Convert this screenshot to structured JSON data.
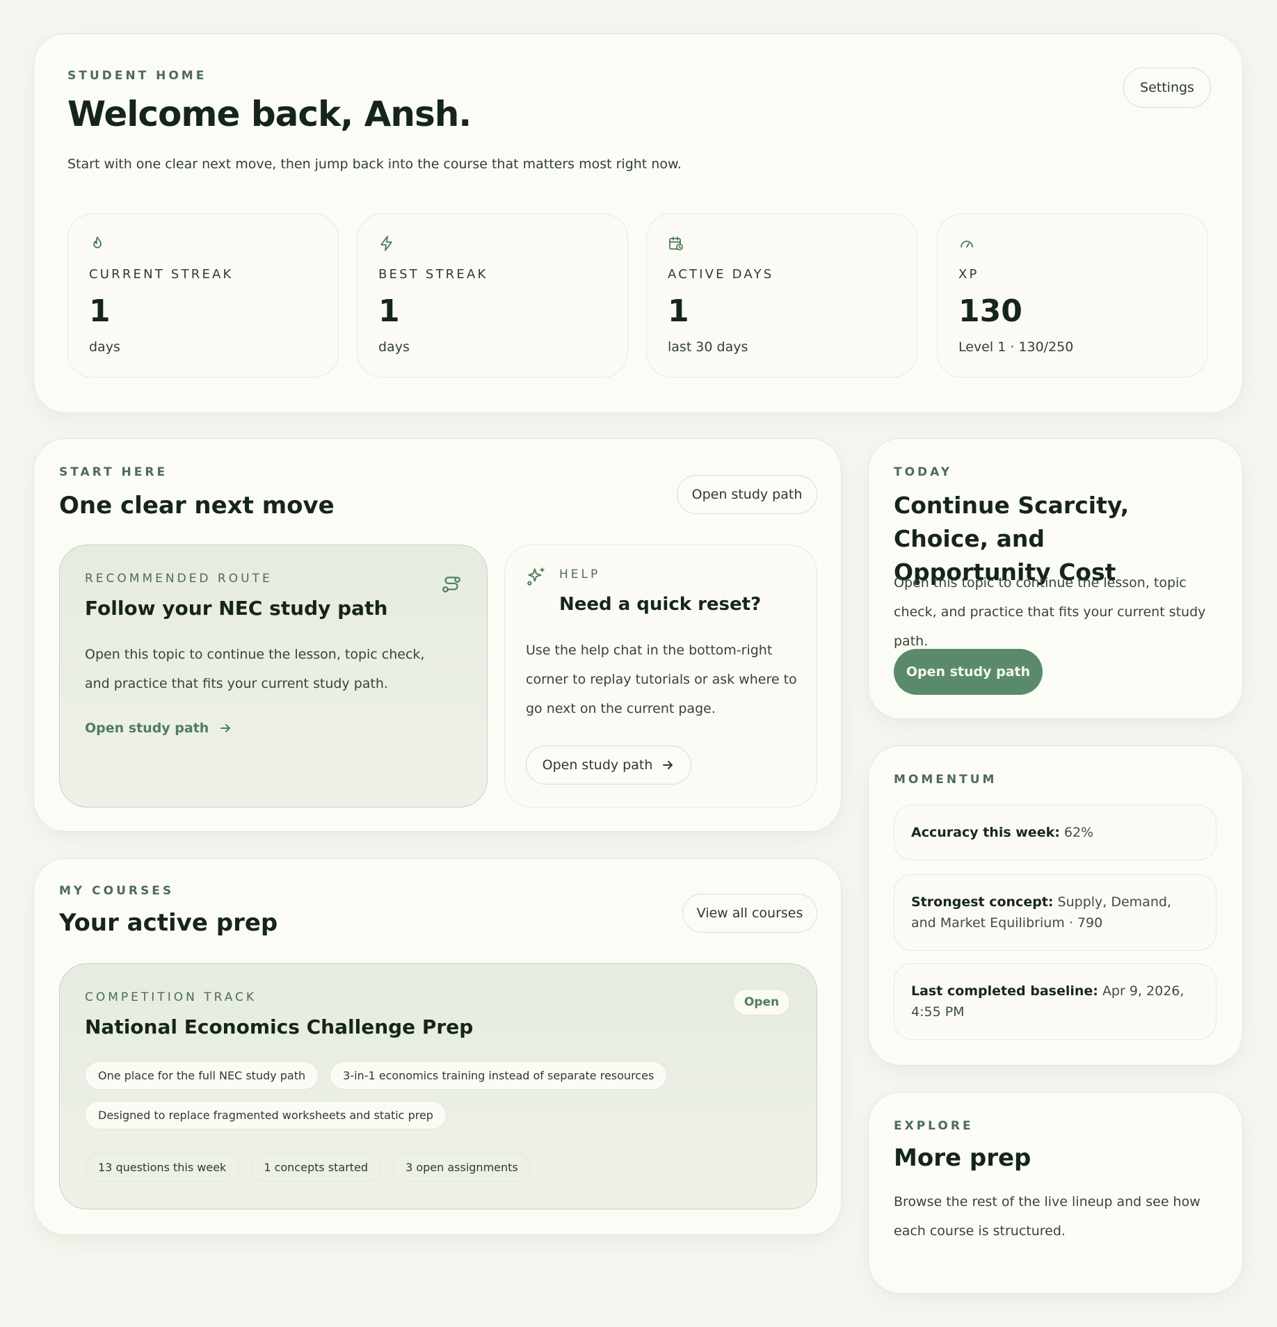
{
  "header": {
    "eyebrow": "STUDENT HOME",
    "title": "Welcome back, Ansh.",
    "subtitle": "Start with one clear next move, then jump back into the course that matters most right now.",
    "settings_label": "Settings"
  },
  "stats": [
    {
      "icon": "flame-icon",
      "label": "CURRENT STREAK",
      "value": "1",
      "sub": "days"
    },
    {
      "icon": "bolt-icon",
      "label": "BEST STREAK",
      "value": "1",
      "sub": "days"
    },
    {
      "icon": "calendar-clock-icon",
      "label": "ACTIVE DAYS",
      "value": "1",
      "sub": "last 30 days"
    },
    {
      "icon": "gauge-icon",
      "label": "XP",
      "value": "130",
      "sub": "Level 1 · 130/250"
    }
  ],
  "start_here": {
    "eyebrow": "START HERE",
    "title": "One clear next move",
    "button": "Open study path",
    "recommended": {
      "eyebrow": "RECOMMENDED ROUTE",
      "title": "Follow your NEC study path",
      "body": "Open this topic to continue the lesson, topic check, and practice that fits your current study path.",
      "link": "Open study path"
    },
    "help": {
      "eyebrow": "HELP",
      "title": "Need a quick reset?",
      "body": "Use the help chat in the bottom-right corner to replay tutorials or ask where to go next on the current page.",
      "button": "Open study path"
    }
  },
  "courses": {
    "eyebrow": "MY COURSES",
    "title": "Your active prep",
    "button": "View all courses",
    "course": {
      "eyebrow": "COMPETITION TRACK",
      "title": "National Economics Challenge Prep",
      "badge": "Open",
      "features": [
        "One place for the full NEC study path",
        "3-in-1 economics training instead of separate resources",
        "Designed to replace fragmented worksheets and static prep"
      ],
      "metrics": [
        "13 questions this week",
        "1 concepts started",
        "3 open assignments"
      ]
    }
  },
  "today": {
    "eyebrow": "TODAY",
    "title": "Continue Scarcity, Choice, and Opportunity Cost",
    "body": "Open this topic to continue the lesson, topic check, and practice that fits your current study path.",
    "button": "Open study path"
  },
  "momentum": {
    "eyebrow": "MOMENTUM",
    "items": [
      {
        "label": "Accuracy this week:",
        "value": "62%"
      },
      {
        "label": "Strongest concept:",
        "value": "Supply, Demand, and Market Equilibrium · 790"
      },
      {
        "label": "Last completed baseline:",
        "value": "Apr 9, 2026, 4:55 PM"
      }
    ]
  },
  "explore": {
    "eyebrow": "EXPLORE",
    "title": "More prep",
    "body": "Browse the rest of the live lineup and see how each course is structured."
  },
  "colors": {
    "background": "#f6f5ef",
    "card": "#fcfcf6",
    "accent": "#5a8a6b",
    "eyebrow": "#4d6b57"
  }
}
